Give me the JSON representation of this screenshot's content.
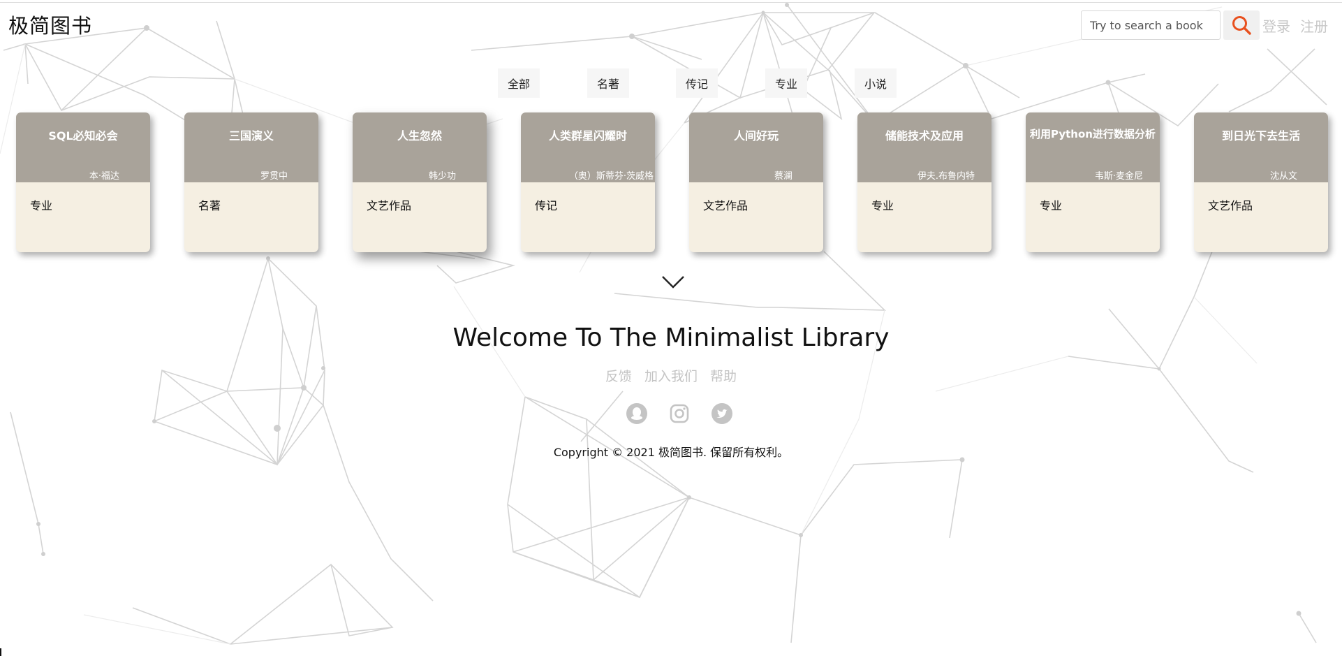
{
  "app": {
    "logo": "极简图书"
  },
  "search": {
    "placeholder": "Try to search a book"
  },
  "auth": {
    "login": "登录",
    "register": "注册"
  },
  "tabs": [
    {
      "label": "全部"
    },
    {
      "label": "名著"
    },
    {
      "label": "传记"
    },
    {
      "label": "专业"
    },
    {
      "label": "小说"
    }
  ],
  "books": [
    {
      "title": "SQL必知必会",
      "author": "本·福达",
      "category": "专业"
    },
    {
      "title": "三国演义",
      "author": "罗贯中",
      "category": "名著"
    },
    {
      "title": "人生忽然",
      "author": "韩少功",
      "category": "文艺作品"
    },
    {
      "title": "人类群星闪耀时",
      "author": "（奥）斯蒂芬·茨威格",
      "category": "传记"
    },
    {
      "title": "人间好玩",
      "author": "蔡澜",
      "category": "文艺作品"
    },
    {
      "title": "储能技术及应用",
      "author": "伊夫.布鲁内特",
      "category": "专业"
    },
    {
      "title": "利用Python进行数据分析",
      "author": "韦斯·麦金尼",
      "category": "专业"
    },
    {
      "title": "到日光下去生活",
      "author": "沈从文",
      "category": "文艺作品"
    }
  ],
  "footer": {
    "welcome": "Welcome To The Minimalist Library",
    "links": [
      "反馈",
      "加入我们",
      "帮助"
    ],
    "social_icons": [
      "qq-icon",
      "instagram-icon",
      "twitter-icon"
    ],
    "copyright": "Copyright © 2021 极简图书. 保留所有权利。"
  },
  "colors": {
    "card_header": "#a9a39a",
    "card_body": "#f5efe2",
    "search_icon": "#e8501e",
    "muted_text": "#c4c4c4"
  }
}
